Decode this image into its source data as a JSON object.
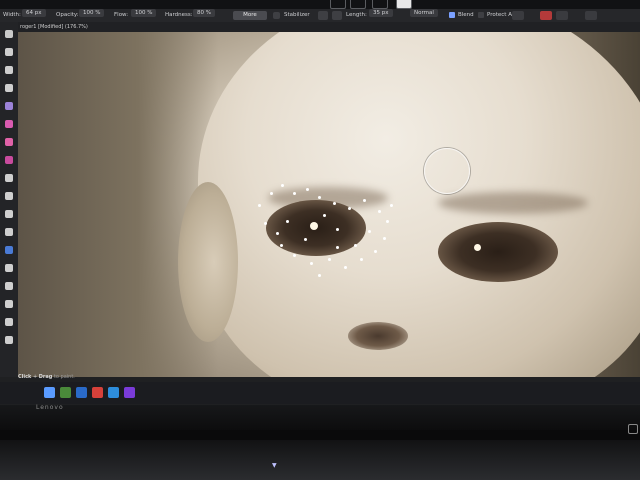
{
  "context_toolbar": {
    "width_label": "Width:",
    "width_value": "64 px",
    "opacity_label": "Opacity:",
    "opacity_value": "100 %",
    "flow_label": "Flow:",
    "flow_value": "100 %",
    "hardness_label": "Hardness:",
    "hardness_value": "80 %",
    "more_label": "More",
    "stabilizer_label": "Stabilizer",
    "length_label": "Length:",
    "length_value": "35 px",
    "blend_mode": "Normal",
    "blend_label": "Blend",
    "protect_alpha_label": "Protect Alpha"
  },
  "document": {
    "tab_title": "roger1 [Modified] (176.7%)"
  },
  "status_bar": {
    "hint_bold": "Click",
    "hint_sep": " + ",
    "hint_action": "Drag",
    "hint_rest": " to paint."
  },
  "laptop": {
    "brand": "Lenovo"
  },
  "colors": {
    "accent": "#7aa0ff",
    "toolbar_bg": "#26272a",
    "canvas_skin": "#e6ddcf"
  },
  "icons": {
    "tools": [
      "move-icon",
      "selection-icon",
      "crop-icon",
      "paint-brush-icon",
      "pixel-icon",
      "erase-icon",
      "fill-icon",
      "gradient-icon",
      "dodge-icon",
      "burn-icon",
      "clone-icon",
      "healing-icon",
      "blemish-icon",
      "red-eye-icon",
      "smudge-icon",
      "text-icon",
      "shape-icon",
      "zoom-icon"
    ],
    "taskbar": [
      "windows-start-icon",
      "file-explorer-icon",
      "store-icon",
      "chrome-icon",
      "edge-icon",
      "affinity-photo-icon"
    ]
  }
}
